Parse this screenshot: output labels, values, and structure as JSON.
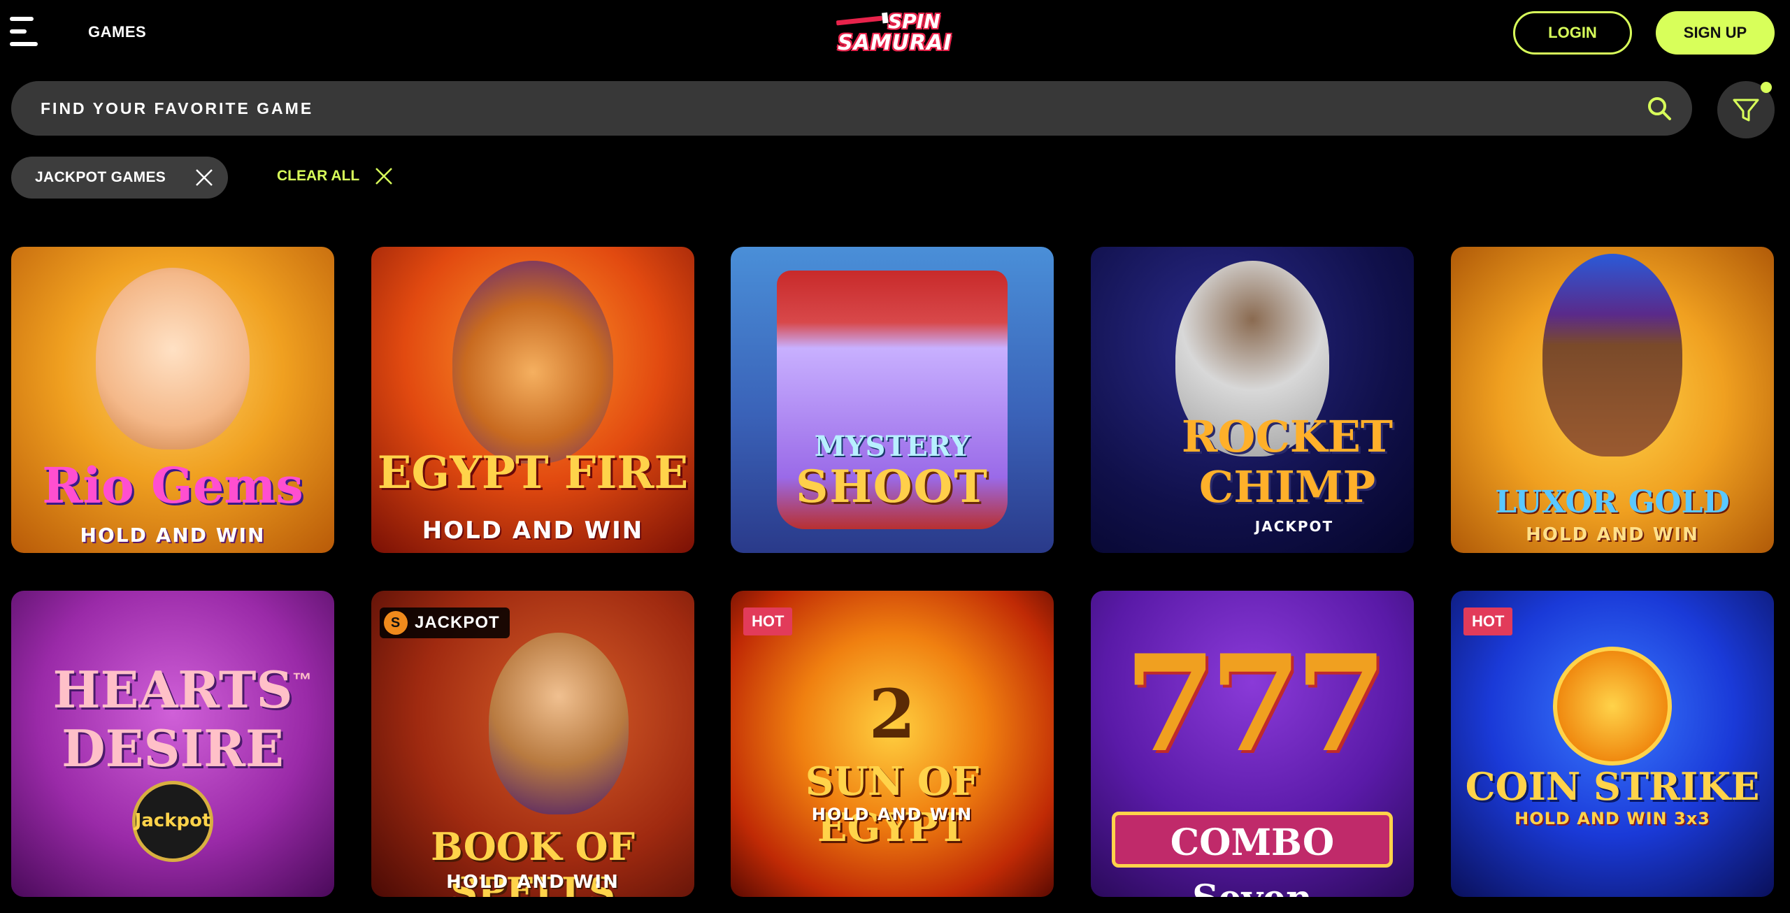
{
  "header": {
    "games_label": "GAMES",
    "logo_line1": "SPIN",
    "logo_line2": "SAMURAI",
    "login_label": "LOGIN",
    "signup_label": "SIGN UP"
  },
  "search": {
    "placeholder": "FIND YOUR FAVORITE GAME"
  },
  "filters": {
    "active_chip": "JACKPOT GAMES",
    "clear_all_label": "CLEAR ALL"
  },
  "colors": {
    "accent": "#d8ff5a",
    "hot_badge": "#e23b5a",
    "background": "#000000"
  },
  "games": [
    {
      "title_main": "Rio Gems",
      "title_sub": "HOLD AND WIN",
      "badge": ""
    },
    {
      "title_main": "EGYPT FIRE",
      "title_sub": "HOLD AND WIN",
      "badge": ""
    },
    {
      "title_main": "MYSTERY",
      "title_sub": "SHOOT",
      "badge": ""
    },
    {
      "title_main": "ROCKET CHIMP",
      "title_sub": "JACKPOT",
      "badge": ""
    },
    {
      "title_main": "LUXOR GOLD",
      "title_sub": "HOLD AND WIN",
      "badge": ""
    },
    {
      "title_main": "HEARTS DESIRE",
      "title_sub": "Jackpot",
      "badge": "",
      "trademark": "™"
    },
    {
      "title_main": "BOOK OF SPELLS",
      "title_sub": "HOLD AND WIN",
      "badge": "JACKPOT"
    },
    {
      "title_main": "SUN OF EGYPT",
      "title_sub": "HOLD AND WIN",
      "badge": "HOT",
      "number": "2"
    },
    {
      "title_main": "COMBO Seven",
      "title_sub": "777",
      "badge": ""
    },
    {
      "title_main": "COIN STRIKE",
      "title_sub": "HOLD AND WIN 3x3",
      "badge": "HOT"
    }
  ]
}
